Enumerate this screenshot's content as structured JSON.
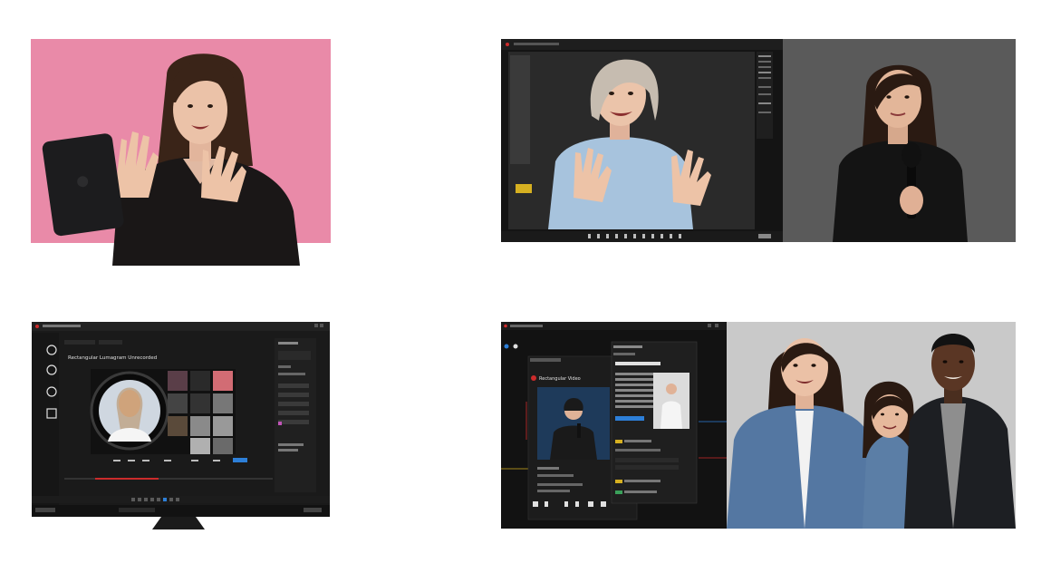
{
  "screens": {
    "bottom_left": {
      "title": "Rectangular Lumagram Unrecorded"
    },
    "bottom_right": {
      "title": "Rectangular Video"
    }
  },
  "colors": {
    "pink_bg": "#e98aa8",
    "dark_ui": "#1a1a1a",
    "grey_studio": "#5a5a5a",
    "light_studio": "#c9c9c9",
    "accent_blue": "#2d7fd8",
    "accent_red": "#cc2b2b",
    "accent_yellow": "#d6b021"
  },
  "icons": [
    "camera-icon",
    "mic-icon",
    "settings-icon",
    "chat-icon",
    "record-icon",
    "play-icon"
  ]
}
